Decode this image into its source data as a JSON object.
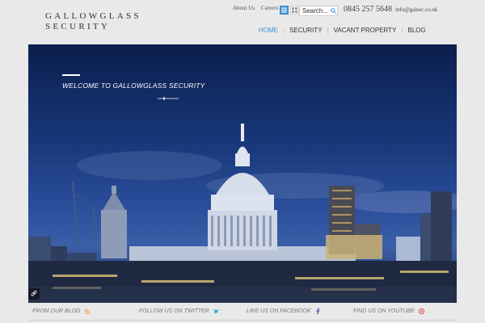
{
  "logo": {
    "line1": "GALLOWGLASS",
    "line2": "SECURITY"
  },
  "header": {
    "top_links": [
      "About Us",
      "Careers"
    ],
    "search_placeholder": "Search...",
    "phone": "0845 257 5648",
    "email": "info@galsec.co.uk"
  },
  "nav": {
    "items": [
      {
        "label": "HOME",
        "active": true
      },
      {
        "label": "SECURITY",
        "active": false
      },
      {
        "label": "VACANT PROPERTY",
        "active": false
      },
      {
        "label": "BLOG",
        "active": false
      }
    ]
  },
  "hero": {
    "title": "WELCOME TO GALLOWGLASS SECURITY"
  },
  "footer": {
    "items": [
      {
        "label": "FROM OUR BLOG",
        "icon": "rss-icon"
      },
      {
        "label": "FOLLOW US ON TWITTER",
        "icon": "twitter-icon"
      },
      {
        "label": "LIKE US ON FACEBOOK",
        "icon": "facebook-icon"
      },
      {
        "label": "FIND US ON YOUTUBE",
        "icon": "youtube-icon"
      }
    ]
  },
  "colors": {
    "accent": "#3d8fd1",
    "rss": "#f39c3a",
    "twitter": "#3aa6e0",
    "facebook": "#3b5998",
    "youtube": "#d9473f"
  }
}
